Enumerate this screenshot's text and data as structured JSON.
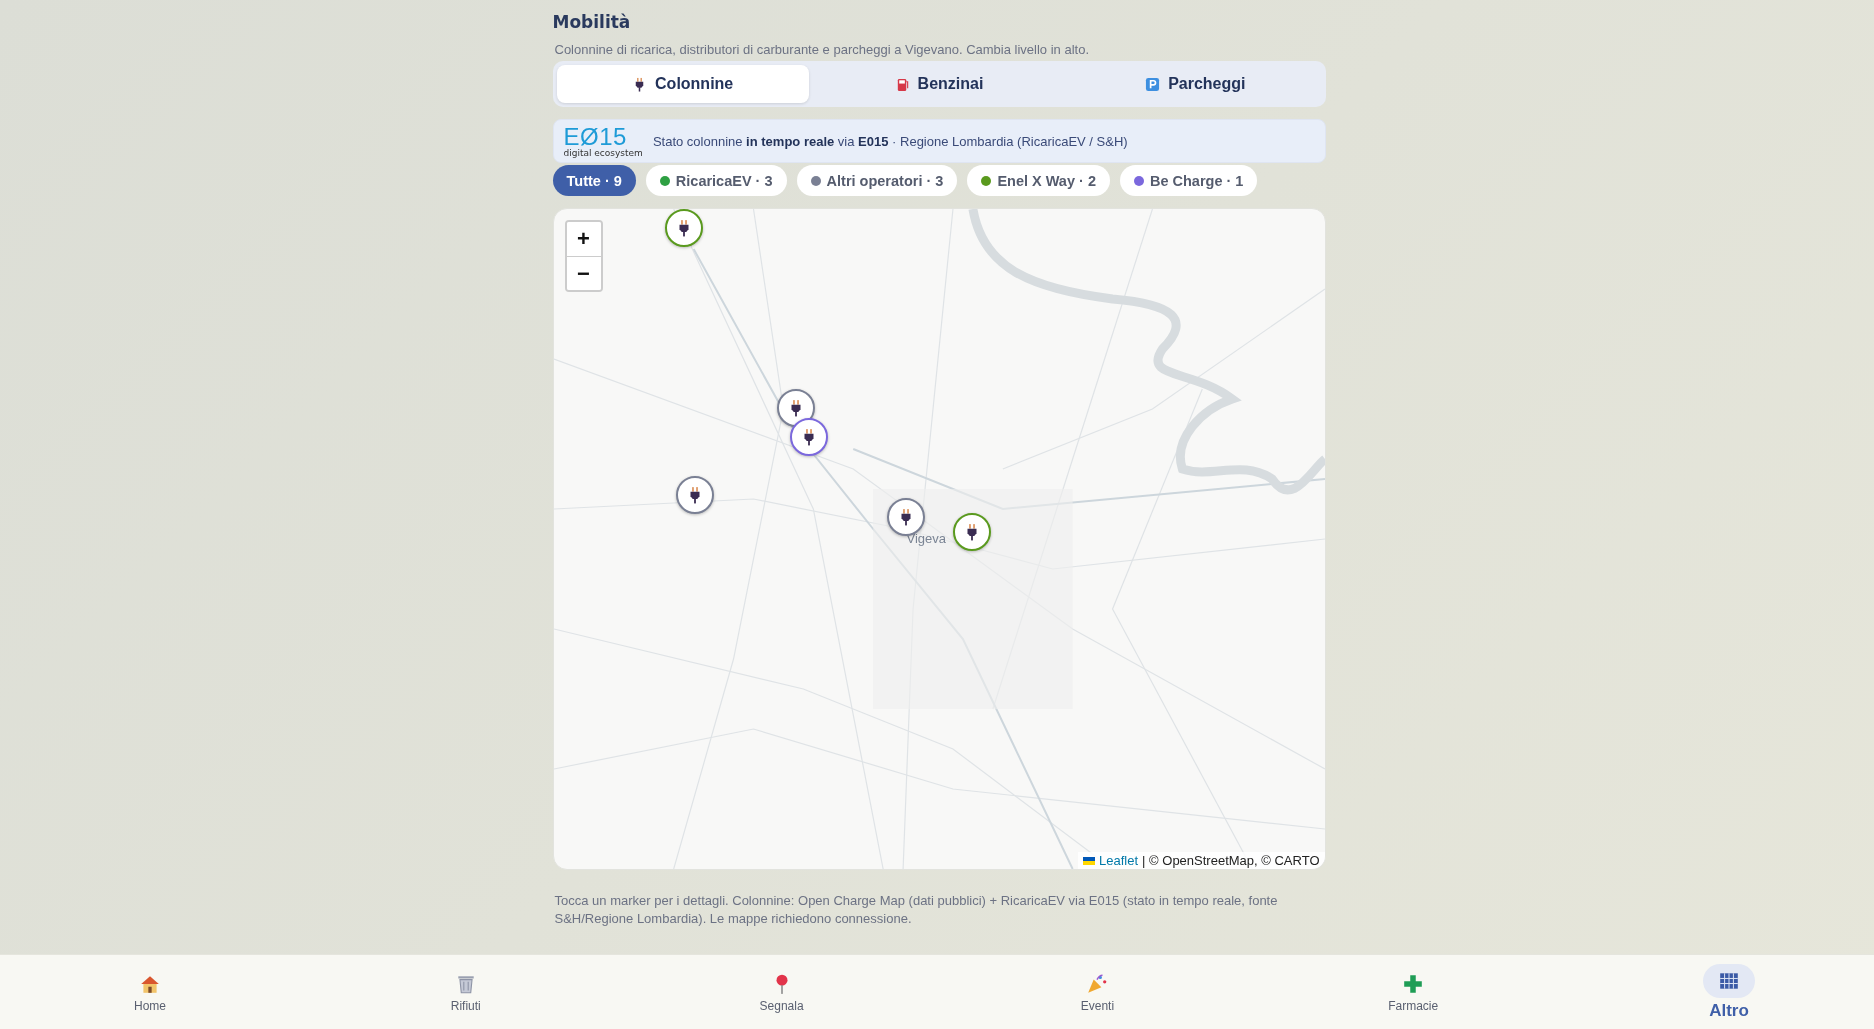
{
  "page": {
    "title": "Mobilità",
    "subtitle": "Colonnine di ricarica, distributori di carburante e parcheggi a Vigevano. Cambia livello in alto."
  },
  "tabs": [
    {
      "kind": "plug",
      "label": "Colonnine",
      "selected": true
    },
    {
      "kind": "fuel",
      "label": "Benzinai",
      "selected": false
    },
    {
      "kind": "parking",
      "label": "Parcheggi",
      "selected": false
    }
  ],
  "banner": {
    "logo": "EØ15",
    "logo_caption": "digital ecosystem",
    "text": "Stato colonnine **in tempo reale** via **E015** · Regione Lombardia (RicaricaEV / S&H)"
  },
  "filters": [
    {
      "label": "Tutte · 9",
      "selected": true
    },
    {
      "label": "RicaricaEV · 3",
      "selected": false,
      "color": "#2ea043"
    },
    {
      "label": "Altri operatori · 3",
      "selected": false,
      "color": "#7a8094"
    },
    {
      "label": "Enel X Way · 2",
      "selected": false,
      "color": "#5a9a1e"
    },
    {
      "label": "Be Charge · 1",
      "selected": false,
      "color": "#7b68dd"
    }
  ],
  "map": {
    "zoom_in": "+",
    "zoom_out": "−",
    "place_label": "Vigeva",
    "markers": [
      {
        "color": "#5a9a1e"
      },
      {
        "color": "#7a8094"
      },
      {
        "color": "#7b68dd"
      },
      {
        "color": "#7a8094"
      },
      {
        "color": "#7a8094"
      },
      {
        "color": "#5a9a1e"
      }
    ],
    "attribution_link": "Leaflet",
    "attribution": "| © OpenStreetMap, © CARTO"
  },
  "note": "Tocca un marker per i dettagli. Colonnine: Open Charge Map (dati pubblici) + RicaricaEV via E015 (stato in tempo reale, fonte S&H/Regione Lombardia). Le mappe richiedono connessione.",
  "nav": [
    {
      "kind": "home",
      "label": "Home",
      "selected": false
    },
    {
      "kind": "bin",
      "label": "Rifiuti",
      "selected": false
    },
    {
      "kind": "pin",
      "label": "Segnala",
      "selected": false
    },
    {
      "kind": "party",
      "label": "Eventi",
      "selected": false
    },
    {
      "kind": "cross",
      "label": "Farmacie",
      "selected": false
    },
    {
      "kind": "grid",
      "label": "Altro",
      "selected": true
    }
  ]
}
